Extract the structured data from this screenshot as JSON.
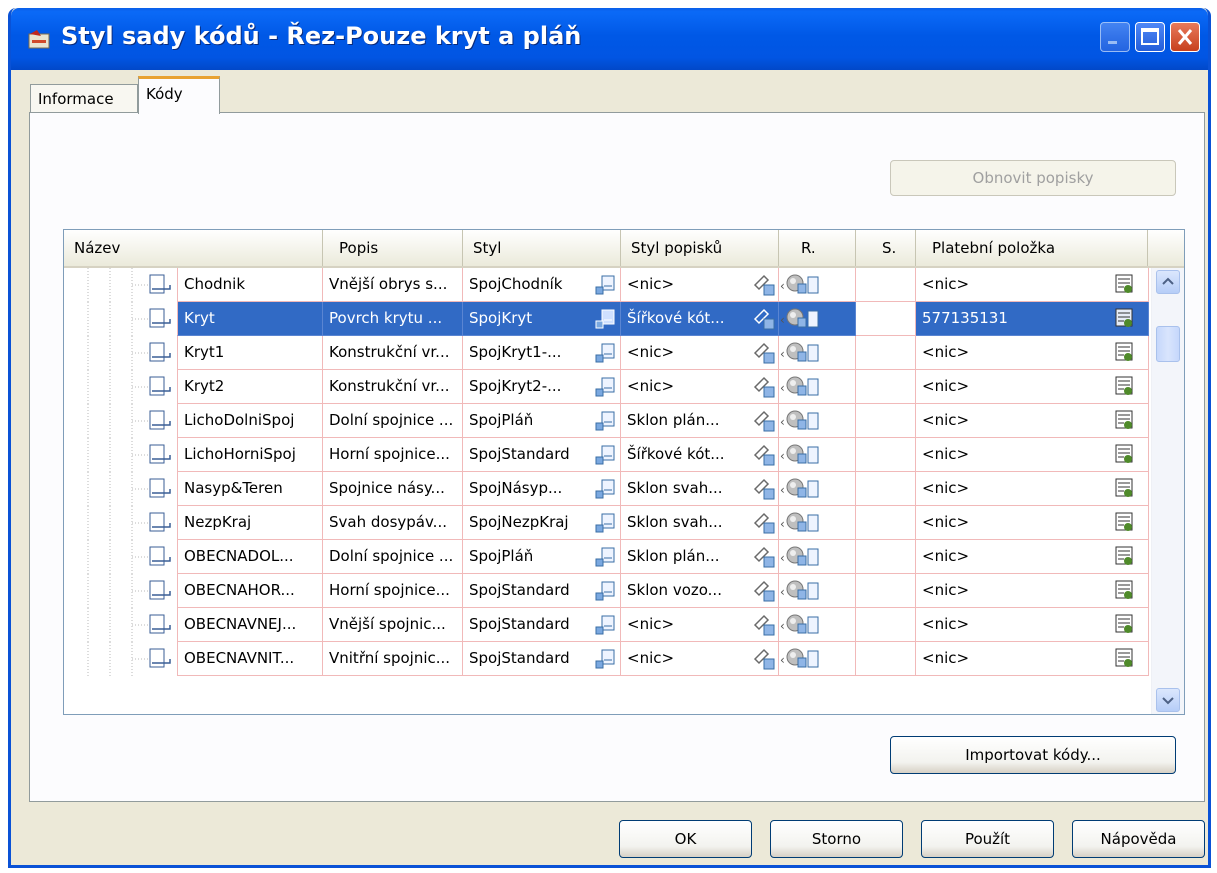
{
  "window": {
    "title": "Styl sady kódů - Řez-Pouze kryt a pláň"
  },
  "tabs": [
    {
      "label": "Informace",
      "active": false
    },
    {
      "label": "Kódy",
      "active": true
    }
  ],
  "buttons": {
    "refresh_labels": "Obnovit popisky",
    "import_codes": "Importovat kódy...",
    "ok": "OK",
    "cancel": "Storno",
    "apply": "Použít",
    "help": "Nápověda"
  },
  "columns": {
    "name": "Název",
    "description": "Popis",
    "style": "Styl",
    "label_style": "Styl popisků",
    "r": "R.",
    "s": "S.",
    "pay_item": "Platební položka"
  },
  "rows": [
    {
      "name": "Chodnik",
      "description": "Vnější obrys s...",
      "style": "SpojChodník",
      "label_style": "<nic>",
      "pay_item": "<nic>",
      "selected": false
    },
    {
      "name": "Kryt",
      "description": "Povrch krytu ...",
      "style": "SpojKryt",
      "label_style": "Šířkové kót...",
      "pay_item": "577135131",
      "selected": true
    },
    {
      "name": "Kryt1",
      "description": "Konstrukční vr...",
      "style": "SpojKryt1-...",
      "label_style": "<nic>",
      "pay_item": "<nic>",
      "selected": false
    },
    {
      "name": "Kryt2",
      "description": "Konstrukční vr...",
      "style": "SpojKryt2-...",
      "label_style": "<nic>",
      "pay_item": "<nic>",
      "selected": false
    },
    {
      "name": "LichoDolniSpoj",
      "description": "Dolní spojnice ...",
      "style": "SpojPláň",
      "label_style": "Sklon plán...",
      "pay_item": "<nic>",
      "selected": false
    },
    {
      "name": "LichoHorniSpoj",
      "description": "Horní spojnice...",
      "style": "SpojStandard",
      "label_style": "Šířkové kót...",
      "pay_item": "<nic>",
      "selected": false
    },
    {
      "name": "Nasyp&Teren",
      "description": "Spojnice násy...",
      "style": "SpojNásyp...",
      "label_style": "Sklon svah...",
      "pay_item": "<nic>",
      "selected": false
    },
    {
      "name": "NezpKraj",
      "description": "Svah dosypáv...",
      "style": "SpojNezpKraj",
      "label_style": "Sklon svah...",
      "pay_item": "<nic>",
      "selected": false
    },
    {
      "name": "OBECNADOL...",
      "description": "Dolní spojnice ...",
      "style": "SpojPláň",
      "label_style": "Sklon plán...",
      "pay_item": "<nic>",
      "selected": false
    },
    {
      "name": "OBECNAHOR...",
      "description": "Horní spojnice...",
      "style": "SpojStandard",
      "label_style": "Sklon vozo...",
      "pay_item": "<nic>",
      "selected": false
    },
    {
      "name": "OBECNAVNEJ...",
      "description": "Vnější spojnic...",
      "style": "SpojStandard",
      "label_style": "<nic>",
      "pay_item": "<nic>",
      "selected": false
    },
    {
      "name": "OBECNAVNIT...",
      "description": "Vnitřní spojnic...",
      "style": "SpojStandard",
      "label_style": "<nic>",
      "pay_item": "<nic>",
      "selected": false
    }
  ],
  "icons": {
    "tree_node": "code-style-icon",
    "style_picker": "style-picker-icon",
    "label_picker": "label-style-picker-icon",
    "render_material": "render-material-icon",
    "pay_item": "pay-item-icon"
  },
  "colors": {
    "title_bar": "#0058e6",
    "selection": "#316ac5",
    "grid_lines": "#f1b9b9",
    "tab_accent": "#e8a232"
  }
}
